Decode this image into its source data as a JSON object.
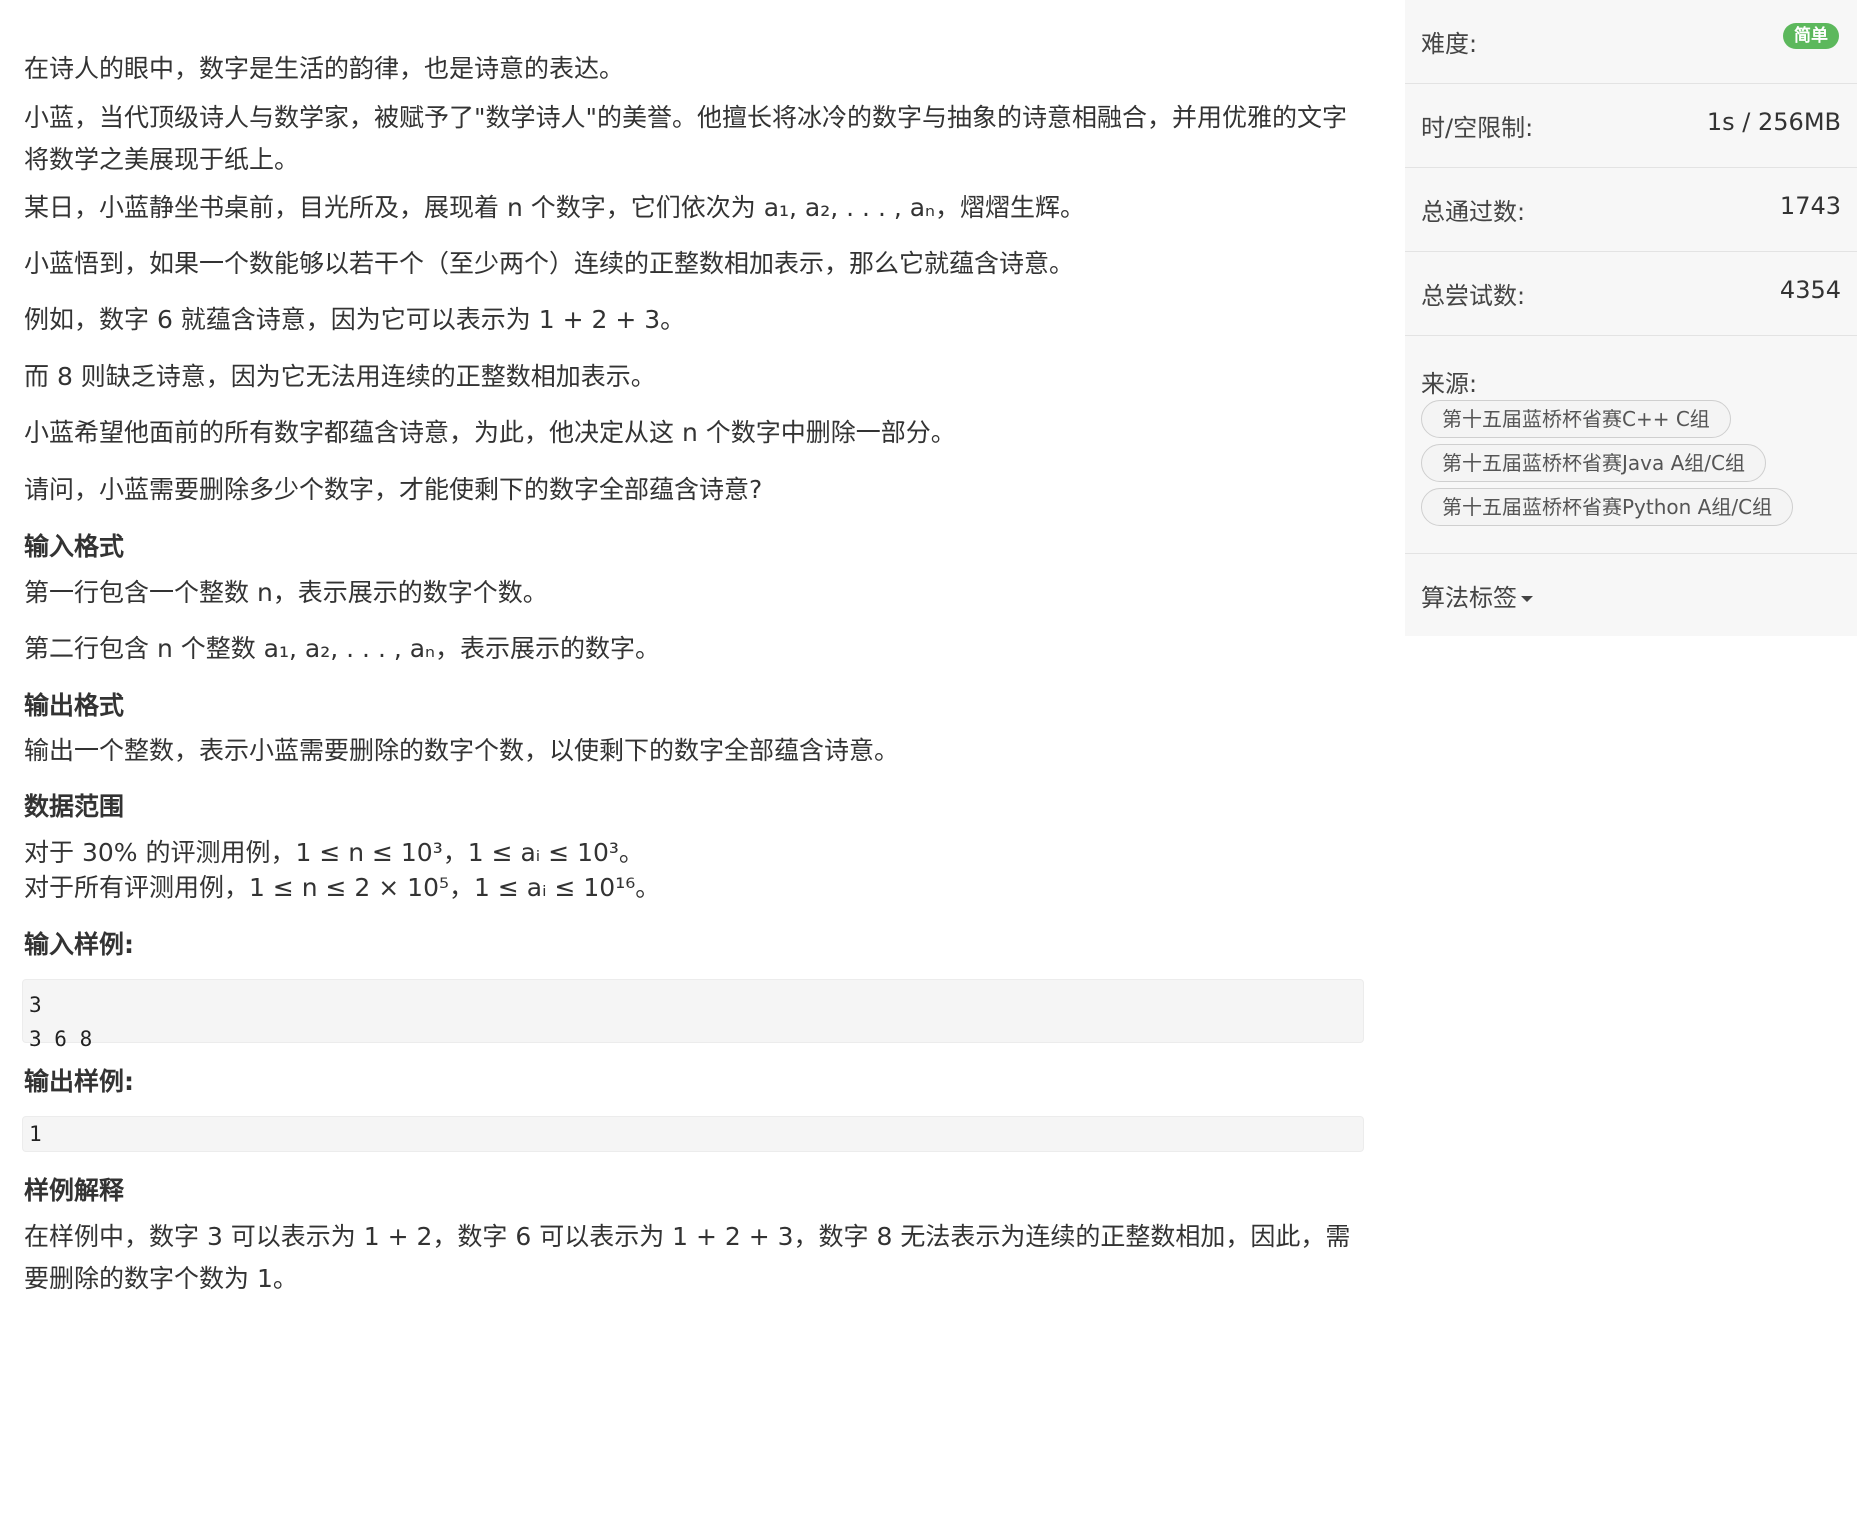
{
  "problem": {
    "p1": "在诗人的眼中，数字是生活的韵律，也是诗意的表达。",
    "p2": "小蓝，当代顶级诗人与数学家，被赋予了\"数学诗人\"的美誉。他擅长将冰冷的数字与抽象的诗意相融合，并用优雅的文字将数学之美展现于纸上。",
    "p3": "某日，小蓝静坐书桌前，目光所及，展现着 n 个数字，它们依次为 a₁, a₂, . . . , aₙ，熠熠生辉。",
    "p4": "小蓝悟到，如果一个数能够以若干个（至少两个）连续的正整数相加表示，那么它就蕴含诗意。",
    "p5": "例如，数字 6 就蕴含诗意，因为它可以表示为 1 + 2 + 3。",
    "p6": "而 8 则缺乏诗意，因为它无法用连续的正整数相加表示。",
    "p7": "小蓝希望他面前的所有数字都蕴含诗意，为此，他决定从这 n 个数字中删除一部分。",
    "p8": "请问，小蓝需要删除多少个数字，才能使剩下的数字全部蕴含诗意?",
    "input_title": "输入格式",
    "input_line1": "第一行包含一个整数 n，表示展示的数字个数。",
    "input_line2": "第二行包含 n 个整数 a₁, a₂, . . . , aₙ，表示展示的数字。",
    "output_title": "输出格式",
    "output_line": "输出一个整数，表示小蓝需要删除的数字个数，以使剩下的数字全部蕴含诗意。",
    "range_title": "数据范围",
    "range_line1": "对于 30% 的评测用例，1 ≤ n ≤ 10³，1 ≤ aᵢ ≤ 10³。",
    "range_line2": "对于所有评测用例，1 ≤ n ≤ 2 × 10⁵，1 ≤ aᵢ ≤ 10¹⁶。",
    "sample_in_title": "输入样例:",
    "sample_in": "3\n3 6 8",
    "sample_out_title": "输出样例:",
    "sample_out": "1",
    "explain_title": "样例解释",
    "explain": "在样例中，数字 3 可以表示为 1 + 2，数字 6 可以表示为 1 + 2 + 3，数字 8 无法表示为连续的正整数相加，因此，需要删除的数字个数为 1。"
  },
  "sidebar": {
    "difficulty_label": "难度:",
    "difficulty_value": "简单",
    "limit_label": "时/空限制:",
    "limit_value": "1s / 256MB",
    "passed_label": "总通过数:",
    "passed_value": "1743",
    "tried_label": "总尝试数:",
    "tried_value": "4354",
    "source_label": "来源:",
    "sources": [
      "第十五届蓝桥杯省赛C++ C组",
      "第十五届蓝桥杯省赛Java A组/C组",
      "第十五届蓝桥杯省赛Python A组/C组"
    ],
    "algo_label": "算法标签"
  },
  "colors": {
    "badge_green": "#5cb85c",
    "sidebar_bg": "#f7f7f7",
    "code_bg": "#f5f5f5"
  }
}
